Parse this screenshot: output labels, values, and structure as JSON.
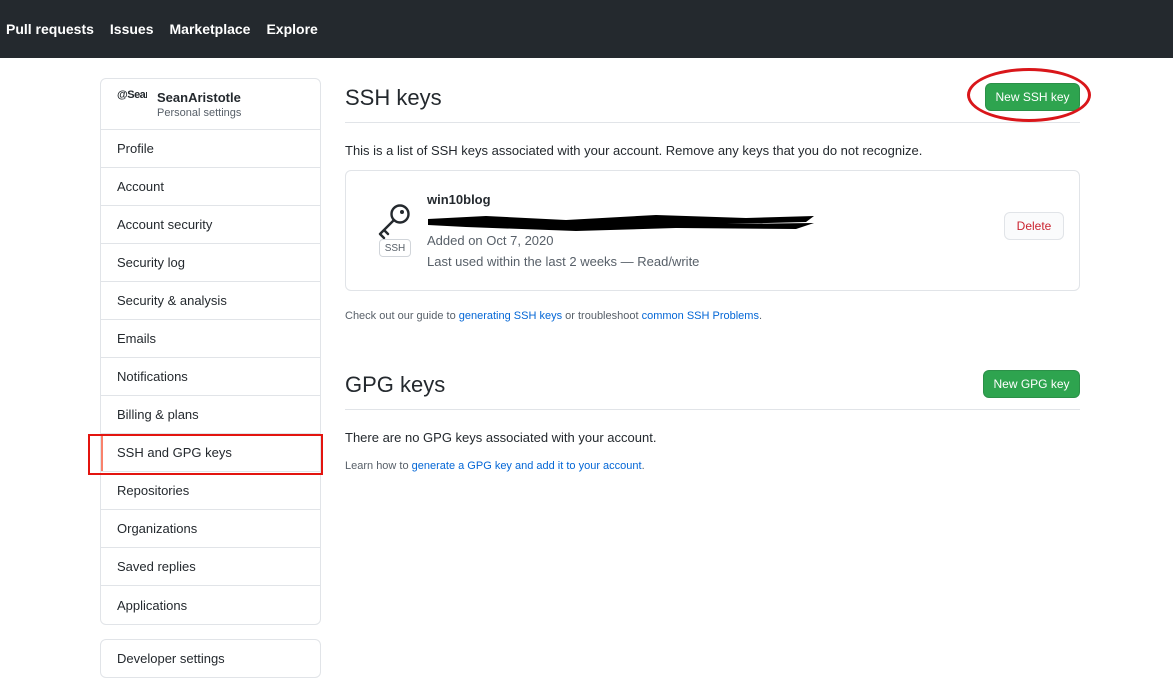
{
  "topnav": {
    "items": [
      "Pull requests",
      "Issues",
      "Marketplace",
      "Explore"
    ]
  },
  "sidebar": {
    "avatar_text": "@SeanAr",
    "username": "SeanAristotle",
    "subtitle": "Personal settings",
    "items": [
      {
        "label": "Profile"
      },
      {
        "label": "Account"
      },
      {
        "label": "Account security"
      },
      {
        "label": "Security log"
      },
      {
        "label": "Security & analysis"
      },
      {
        "label": "Emails"
      },
      {
        "label": "Notifications"
      },
      {
        "label": "Billing & plans"
      },
      {
        "label": "SSH and GPG keys",
        "active": true
      },
      {
        "label": "Repositories"
      },
      {
        "label": "Organizations"
      },
      {
        "label": "Saved replies"
      },
      {
        "label": "Applications"
      }
    ],
    "developer_settings": "Developer settings"
  },
  "ssh": {
    "title": "SSH keys",
    "new_button": "New SSH key",
    "description": "This is a list of SSH keys associated with your account. Remove any keys that you do not recognize.",
    "key": {
      "name": "win10blog",
      "badge": "SSH",
      "added": "Added on Oct 7, 2020",
      "last_used": "Last used within the last 2 weeks — Read/write",
      "delete_label": "Delete"
    },
    "guide_pre": "Check out our guide to ",
    "guide_link1": "generating SSH keys",
    "guide_mid": " or troubleshoot ",
    "guide_link2": "common SSH Problems",
    "guide_post": "."
  },
  "gpg": {
    "title": "GPG keys",
    "new_button": "New GPG key",
    "empty": "There are no GPG keys associated with your account.",
    "learn_pre": "Learn how to ",
    "learn_link": "generate a GPG key and add it to your account",
    "learn_post": "."
  },
  "colors": {
    "header_bg": "#24292e",
    "primary_green": "#2ea44f",
    "link_blue": "#0366d6",
    "danger_red": "#cb2431",
    "annotation_red": "#e3140f"
  }
}
